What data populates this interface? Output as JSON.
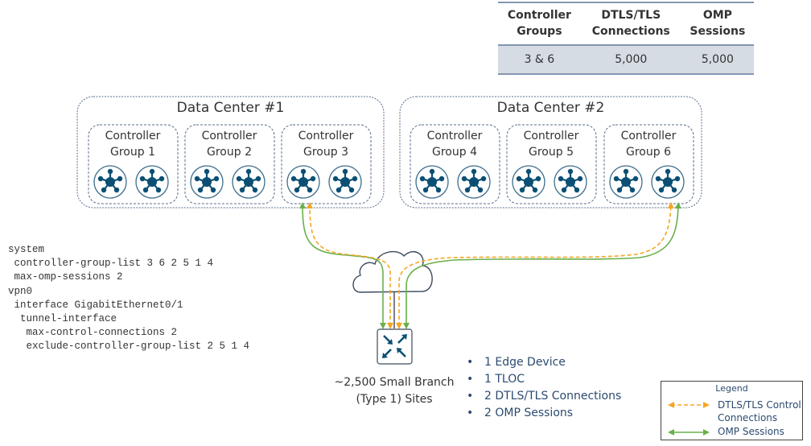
{
  "table": {
    "headers": [
      {
        "line1": "Controller",
        "line2": "Groups"
      },
      {
        "line1": "DTLS/TLS",
        "line2": "Connections"
      },
      {
        "line1": "OMP",
        "line2": "Sessions"
      }
    ],
    "row": [
      "3 & 6",
      "5,000",
      "5,000"
    ]
  },
  "data_centers": [
    {
      "title": "Data Center #1",
      "groups": [
        {
          "line1": "Controller",
          "line2": "Group 1",
          "controllers": 2
        },
        {
          "line1": "Controller",
          "line2": "Group 2",
          "controllers": 2
        },
        {
          "line1": "Controller",
          "line2": "Group 3",
          "controllers": 2
        }
      ]
    },
    {
      "title": "Data Center #2",
      "groups": [
        {
          "line1": "Controller",
          "line2": "Group 4",
          "controllers": 2
        },
        {
          "line1": "Controller",
          "line2": "Group 5",
          "controllers": 2
        },
        {
          "line1": "Controller",
          "line2": "Group 6",
          "controllers": 2
        }
      ]
    }
  ],
  "config_lines": [
    "system",
    " controller-group-list 3 6 2 5 1 4",
    " max-omp-sessions 2",
    "vpn0",
    " interface GigabitEthernet0/1",
    "  tunnel-interface",
    "   max-control-connections 2",
    "   exclude-controller-group-list 2 5 1 4"
  ],
  "site": {
    "line1": "~2,500 Small Branch",
    "line2": "(Type 1) Sites",
    "icon": "router-icon"
  },
  "bullets": [
    "1 Edge Device",
    "1 TLOC",
    "2 DTLS/TLS Connections",
    "2 OMP Sessions"
  ],
  "legend": {
    "title": "Legend",
    "dtls_line1": "DTLS/TLS  Control",
    "dtls_line2": "Connections",
    "omp": "OMP Sessions"
  },
  "colors": {
    "controller": "#0b4f74",
    "dtls": "#f5a623",
    "omp": "#6ab04c",
    "border": "#5a6e8c",
    "text_blue": "#2b4a6f",
    "table_row": "#d6dce4"
  },
  "connections": [
    {
      "type": "dtls",
      "to_group": "Group 3"
    },
    {
      "type": "omp",
      "to_group": "Group 3"
    },
    {
      "type": "dtls",
      "to_group": "Group 6"
    },
    {
      "type": "omp",
      "to_group": "Group 6"
    }
  ]
}
